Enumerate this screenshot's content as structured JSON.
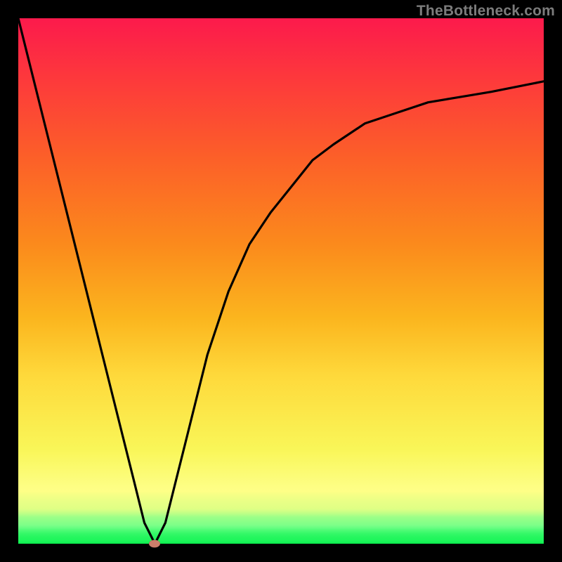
{
  "watermark": "TheBottleneck.com",
  "chart_data": {
    "type": "line",
    "title": "",
    "xlabel": "",
    "ylabel": "",
    "xlim": [
      0,
      1
    ],
    "ylim": [
      0,
      1
    ],
    "grid": false,
    "legend_position": "none",
    "series": [
      {
        "name": "curve",
        "x": [
          0.0,
          0.05,
          0.1,
          0.15,
          0.2,
          0.22,
          0.24,
          0.26,
          0.28,
          0.3,
          0.32,
          0.34,
          0.36,
          0.4,
          0.44,
          0.48,
          0.52,
          0.56,
          0.6,
          0.66,
          0.72,
          0.78,
          0.84,
          0.9,
          1.0
        ],
        "y": [
          1.0,
          0.8,
          0.6,
          0.4,
          0.2,
          0.12,
          0.04,
          0.0,
          0.04,
          0.12,
          0.2,
          0.28,
          0.36,
          0.48,
          0.57,
          0.63,
          0.68,
          0.73,
          0.76,
          0.8,
          0.82,
          0.84,
          0.85,
          0.86,
          0.88
        ]
      }
    ],
    "marker": {
      "x": 0.26,
      "y": 0.0
    },
    "background_gradient": {
      "direction": "vertical",
      "stops": [
        {
          "pos": 0.0,
          "color": "#fc1a4c"
        },
        {
          "pos": 0.5,
          "color": "#fca31d"
        },
        {
          "pos": 0.82,
          "color": "#f9f658"
        },
        {
          "pos": 1.0,
          "color": "#0ef658"
        }
      ]
    }
  }
}
